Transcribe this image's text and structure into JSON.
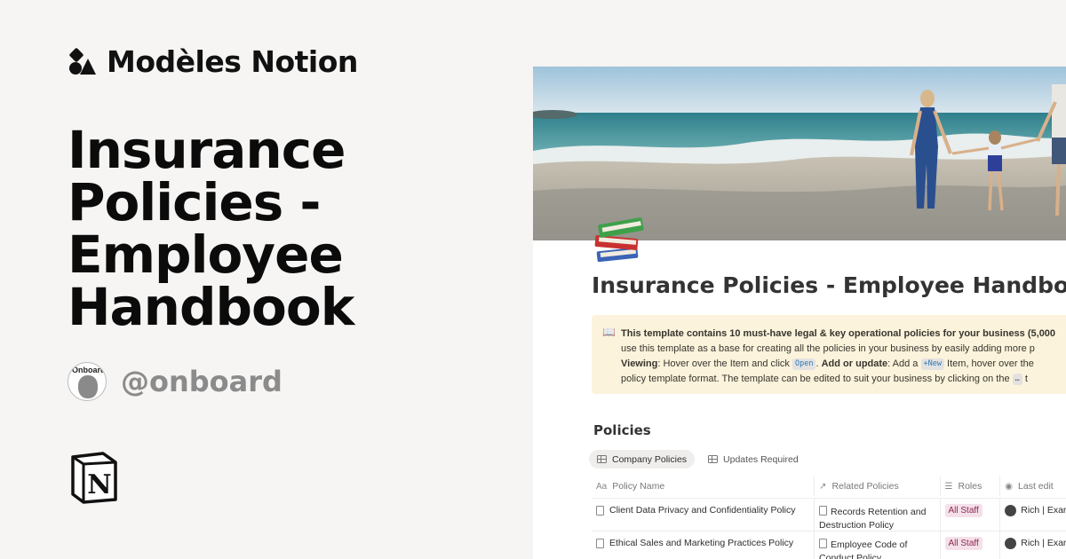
{
  "brand": {
    "name": "Modèles Notion",
    "logo_icon": "shapes-logo-icon"
  },
  "hero": {
    "title": "Insurance Policies - Employee Handbook"
  },
  "author": {
    "handle": "@onboard",
    "avatar_label": "Onboard"
  },
  "notion_logo": {
    "icon": "notion-n-logo-icon"
  },
  "preview": {
    "page_icon": "books-icon",
    "page_title": "Insurance Policies - Employee Handbook",
    "callout": {
      "icon": "📖",
      "line1": "This template contains 10 must-have legal & key operational policies for your business (5,000",
      "line2": "use this template as a base for creating all the policies in your business by easily adding more p",
      "line3_label": "Viewing",
      "line3_a": ": Hover over the Item and click",
      "chip_open": "Open",
      "line3_b": ".",
      "line3_label2": "Add or update",
      "line3_c": ": Add a",
      "chip_new": "+New",
      "line3_d": "Item, hover over the",
      "line4": "policy template format. The template can be edited to suit your business by clicking on the",
      "chip_dots": "…",
      "line4_end": "t"
    },
    "section_title": "Policies",
    "views": [
      {
        "label": "Company Policies",
        "active": true
      },
      {
        "label": "Updates Required",
        "active": false
      }
    ],
    "columns": {
      "name": {
        "label": "Policy Name",
        "icon": "Aa"
      },
      "related": {
        "label": "Related Policies",
        "icon": "↗"
      },
      "roles": {
        "label": "Roles",
        "icon": "☰"
      },
      "edit": {
        "label": "Last edit",
        "icon": "◉"
      }
    },
    "rows": [
      {
        "name": "Client Data Privacy and Confidentiality Policy",
        "related": "Records Retention and Destruction Policy",
        "role": "All Staff",
        "editor": "Rich | Exar"
      },
      {
        "name": "Ethical Sales and Marketing Practices Policy",
        "related": "Employee Code of Conduct Policy",
        "role": "All Staff",
        "editor": "Rich | Exar"
      }
    ],
    "colors": {
      "callout_bg": "#fbf3db",
      "tag_bg": "#f5e0e9",
      "tag_text": "#8b2a53"
    }
  }
}
